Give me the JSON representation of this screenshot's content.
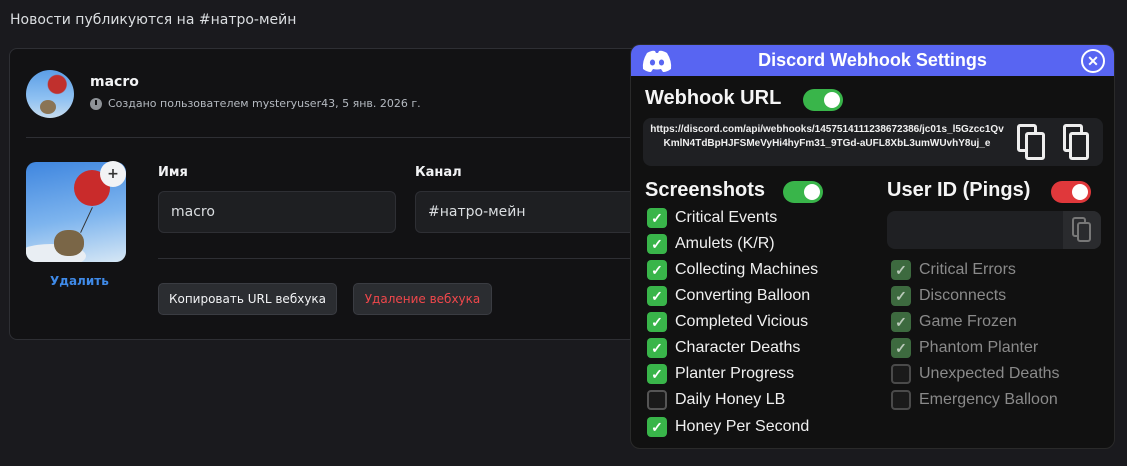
{
  "page": {
    "notice": "Новости публикуются на #натро-мейн"
  },
  "webhook_card": {
    "name": "macro",
    "created": "Создано пользователем mysteryuser43, 5 янв. 2026 г.",
    "delete_avatar": "Удалить",
    "name_label": "Имя",
    "name_value": "macro",
    "channel_label": "Канал",
    "channel_value": "#натро-мейн",
    "copy_url_button": "Копировать URL вебхука",
    "delete_webhook_button": "Удаление вебхука"
  },
  "panel": {
    "title": "Discord Webhook Settings",
    "webhook_url_label": "Webhook URL",
    "webhook_url_enabled": true,
    "webhook_url": "https://discord.com/api/webhooks/1457514111238672386/jc01s_l5Gzcc1QvKmlN4TdBpHJFSMeVyHi4hyFm31_9TGd-aUFL8XbL3umWUvhY8uj_e",
    "screenshots_label": "Screenshots",
    "screenshots_enabled": true,
    "user_id_label": "User ID (Pings)",
    "user_id_enabled": false,
    "screenshots": [
      {
        "label": "Critical Events",
        "checked": true
      },
      {
        "label": "Amulets (K/R)",
        "checked": true
      },
      {
        "label": "Collecting Machines",
        "checked": true
      },
      {
        "label": "Converting Balloon",
        "checked": true
      },
      {
        "label": "Completed Vicious",
        "checked": true
      },
      {
        "label": "Character Deaths",
        "checked": true
      },
      {
        "label": "Planter Progress",
        "checked": true
      },
      {
        "label": "Daily Honey LB",
        "checked": false
      },
      {
        "label": "Honey Per Second",
        "checked": true
      }
    ],
    "pings": [
      {
        "label": "Critical Errors",
        "checked": true
      },
      {
        "label": "Disconnects",
        "checked": true
      },
      {
        "label": "Game Frozen",
        "checked": true
      },
      {
        "label": "Phantom Planter",
        "checked": true
      },
      {
        "label": "Unexpected Deaths",
        "checked": false
      },
      {
        "label": "Emergency Balloon",
        "checked": false
      }
    ],
    "colors": {
      "header": "#5865f2",
      "toggle_on": "#39b54a",
      "toggle_off": "#e0383b"
    }
  }
}
